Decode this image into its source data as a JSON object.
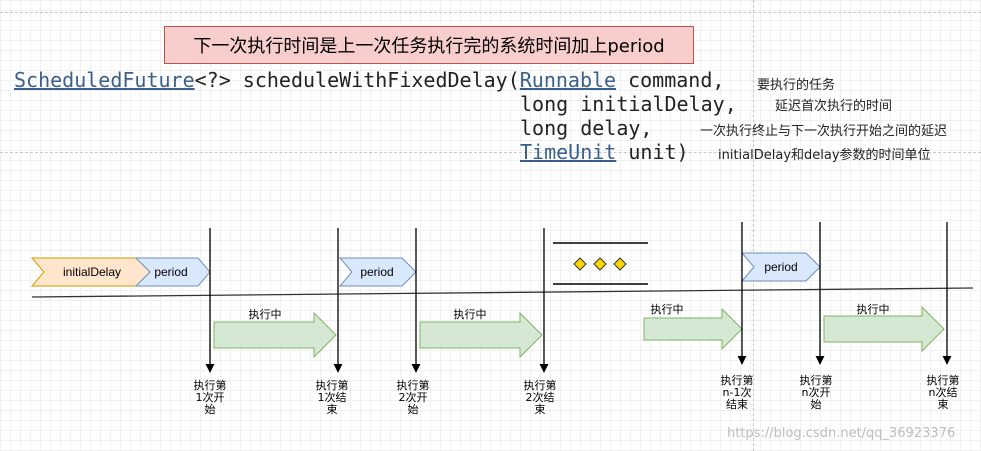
{
  "banner": "下一次执行时间是上一次任务执行完的系统时间加上period",
  "code": {
    "return_type": "ScheduledFuture",
    "generic": "<?>",
    "method": " scheduleWithFixedDelay(",
    "p1_type": "Runnable",
    "p1_name": " command,",
    "p2": "long initialDelay,",
    "p3": "long delay,",
    "p4_type": "TimeUnit",
    "p4_name": " unit)"
  },
  "annotations": {
    "command": "要执行的任务",
    "initial_delay": "延迟首次执行的时间",
    "delay": "一次执行终止与下一次执行开始之间的延迟",
    "unit": "initialDelay和delay参数的时间单位"
  },
  "timeline": {
    "initial_delay_label": "initialDelay",
    "period_label": "period",
    "executing_label": "执行中",
    "events": [
      [
        "执行第",
        "1次开",
        "始"
      ],
      [
        "执行第",
        "1次结",
        "束"
      ],
      [
        "执行第",
        "2次开",
        "始"
      ],
      [
        "执行第",
        "2次结",
        "束"
      ],
      [
        "执行第",
        "n-1次",
        "结束"
      ],
      [
        "执行第",
        "n次开",
        "始"
      ],
      [
        "执行第",
        "n次结",
        "束"
      ]
    ]
  },
  "colors": {
    "banner_fill": "#f8cecc",
    "initial_delay_fill": "#ffe6cc",
    "period_fill": "#dae8fc",
    "arrow_fill": "#d5e8d4",
    "ellipsis_diamond": "#ffd700"
  },
  "watermark": "https://blog.csdn.net/qq_36923376"
}
